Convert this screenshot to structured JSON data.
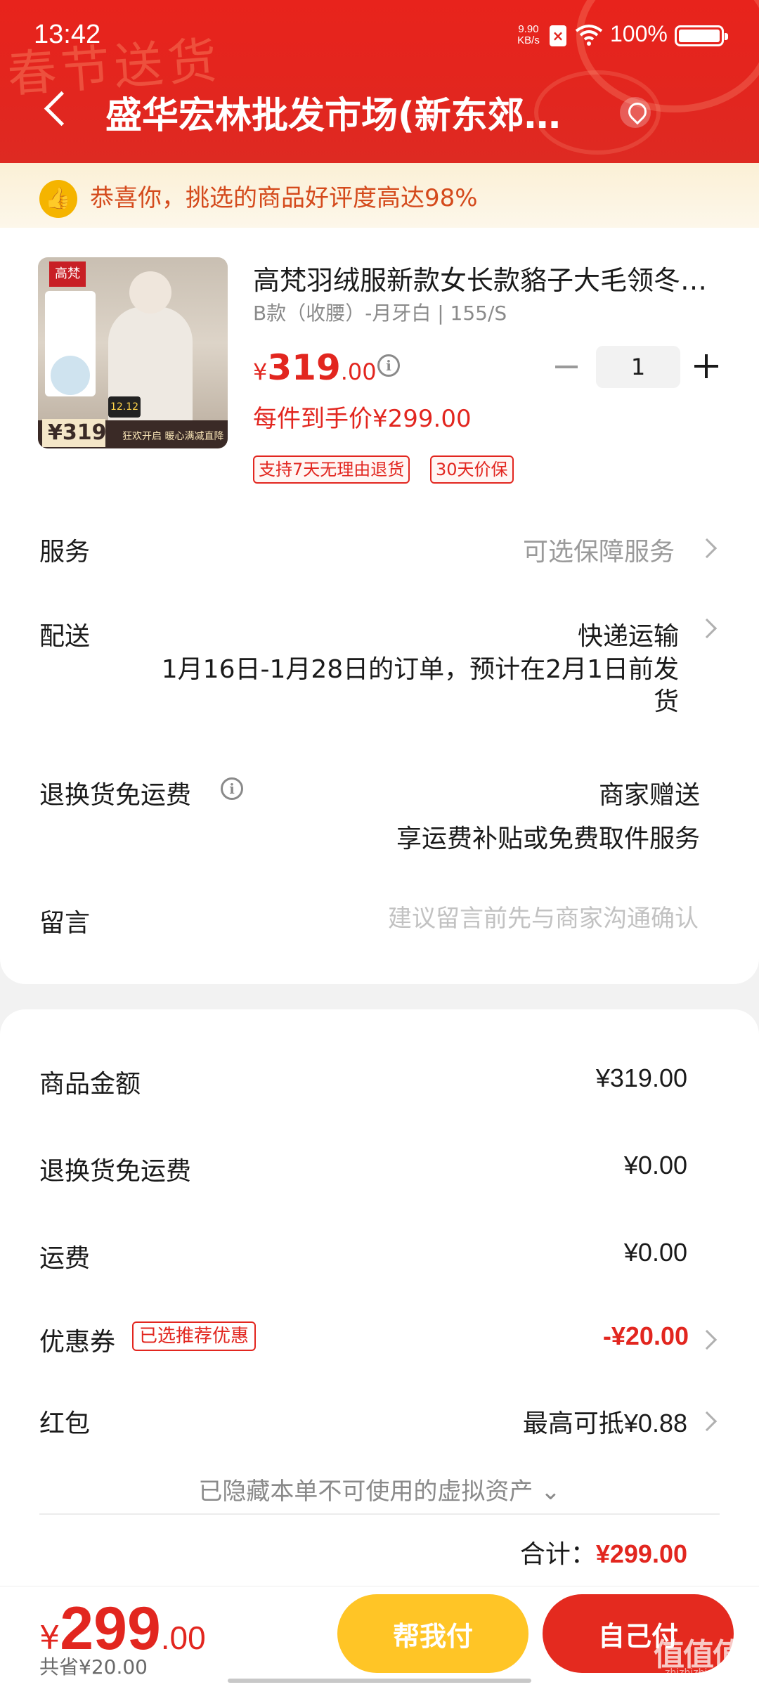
{
  "status_bar": {
    "time": "13:42",
    "net_speed": "9.90\nKB/s",
    "battery": "100%"
  },
  "header": {
    "title": "盛华宏林批发市场(新东郊…",
    "back_icon": "chevron-left-icon",
    "location_icon": "location-pin-icon"
  },
  "notice": {
    "icon": "thumbs-up-icon",
    "text": "恭喜你，挑选的商品好评度高达98%"
  },
  "product": {
    "title": "高梵羽绒服新款女长款貉子大毛领冬…",
    "sku": "B款（收腰）-月牙白 | 155/S",
    "price_yen": "¥",
    "price_int": "319",
    "price_dec": ".00",
    "quantity": "1",
    "unit_price": "每件到手价¥299.00",
    "tags": [
      "支持7天无理由退货",
      "30天价保"
    ],
    "image": {
      "brand": "高梵",
      "price": "¥319",
      "badge": "12.12",
      "slogan": "狂欢开启 暖心满减直降"
    }
  },
  "service": {
    "label": "服务",
    "value": "可选保障服务"
  },
  "delivery": {
    "label": "配送",
    "value": "快递运输",
    "note": "1月16日-1月28日的订单，预计在2月1日前发货"
  },
  "return_freight": {
    "label": "退换货免运费",
    "value": "商家赠送",
    "note": "享运费补贴或免费取件服务"
  },
  "message": {
    "label": "留言",
    "placeholder": "建议留言前先与商家沟通确认"
  },
  "summary": {
    "items": [
      {
        "label": "商品金额",
        "value": "¥319.00"
      },
      {
        "label": "退换货免运费",
        "value": "¥0.00"
      },
      {
        "label": "运费",
        "value": "¥0.00"
      }
    ],
    "coupon": {
      "label": "优惠券",
      "tag": "已选推荐优惠",
      "value": "-¥20.00"
    },
    "red_packet": {
      "label": "红包",
      "value": "最高可抵¥0.88"
    },
    "hidden_assets": "已隐藏本单不可使用的虚拟资产 ⌄",
    "total_label": "合计：",
    "total_value": "¥299.00"
  },
  "bottom_bar": {
    "price_yen": "¥",
    "price_int": "299",
    "price_dec": ".00",
    "saved": "共省¥20.00",
    "help_pay": "帮我付",
    "self_pay": "自己付",
    "watermark": "值值值",
    "watermark_sub": "zhizhizhi.com"
  },
  "colors": {
    "brand_red": "#e2261f",
    "help_yellow": "#ffc526",
    "notice_bg": "#fbf0d6"
  }
}
